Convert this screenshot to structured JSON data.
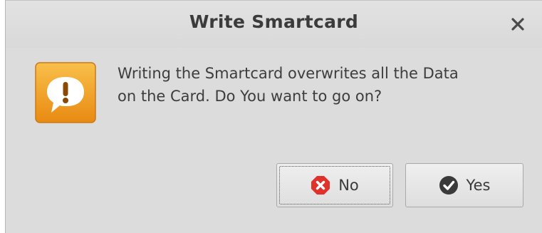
{
  "dialog": {
    "title": "Write Smartcard",
    "message_line1": "Writing the Smartcard overwrites all the Data",
    "message_line2": "on the Card. Do You want to go on?",
    "icon": "warning-speech-bubble-icon"
  },
  "buttons": {
    "no_label": "No",
    "no_icon": "cancel-x-icon",
    "yes_label": "Yes",
    "yes_icon": "checkmark-icon",
    "close_icon": "close-icon"
  },
  "colors": {
    "accent_orange": "#f4a524",
    "no_red": "#e0322a",
    "yes_dark": "#3a3a3a",
    "dialog_bg": "#dcdcdc"
  }
}
